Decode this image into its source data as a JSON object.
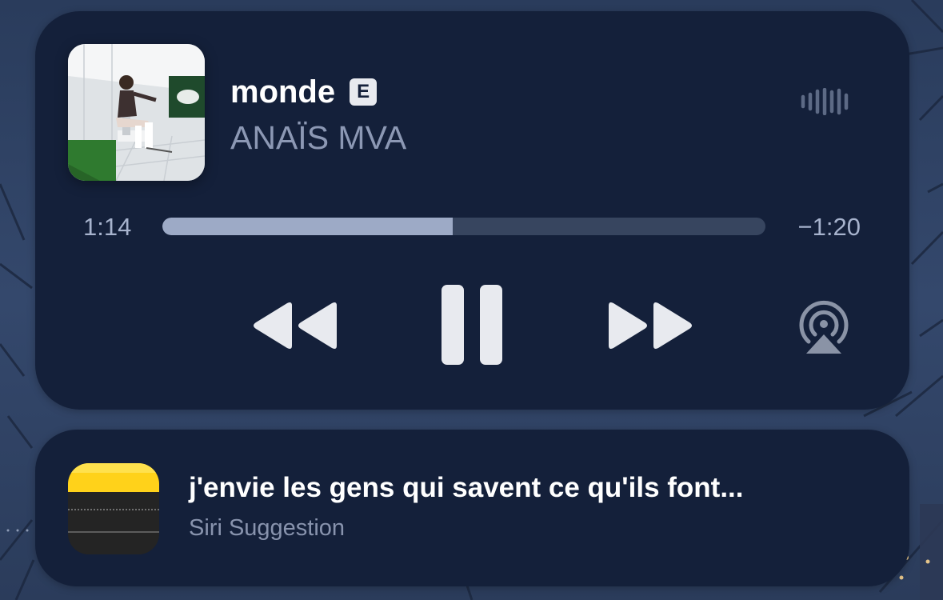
{
  "colors": {
    "card_background": "#14203a",
    "progress_track": "#37455f",
    "progress_fill": "#9daac6",
    "primary_text": "#ffffff",
    "secondary_text": "#8c98b4",
    "control_icons": "#e8eaef",
    "notes_yellow": "#ffd21a"
  },
  "now_playing": {
    "title": "monde",
    "explicit_badge": "E",
    "artist": "ANAÏS MVA",
    "artwork_icon": "album-artwork",
    "waveform_icon": "audio-waveform-icon",
    "elapsed": "1:14",
    "remaining": "−1:20",
    "progress_fraction": 0.481,
    "controls": {
      "rewind_icon": "rewind-icon",
      "pause_icon": "pause-icon",
      "forward_icon": "fast-forward-icon",
      "airplay_icon": "airplay-icon"
    }
  },
  "suggestion": {
    "app_icon": "notes-app-icon",
    "title": "j'envie les gens qui savent ce qu'ils font...",
    "subtitle": "Siri Suggestion"
  }
}
